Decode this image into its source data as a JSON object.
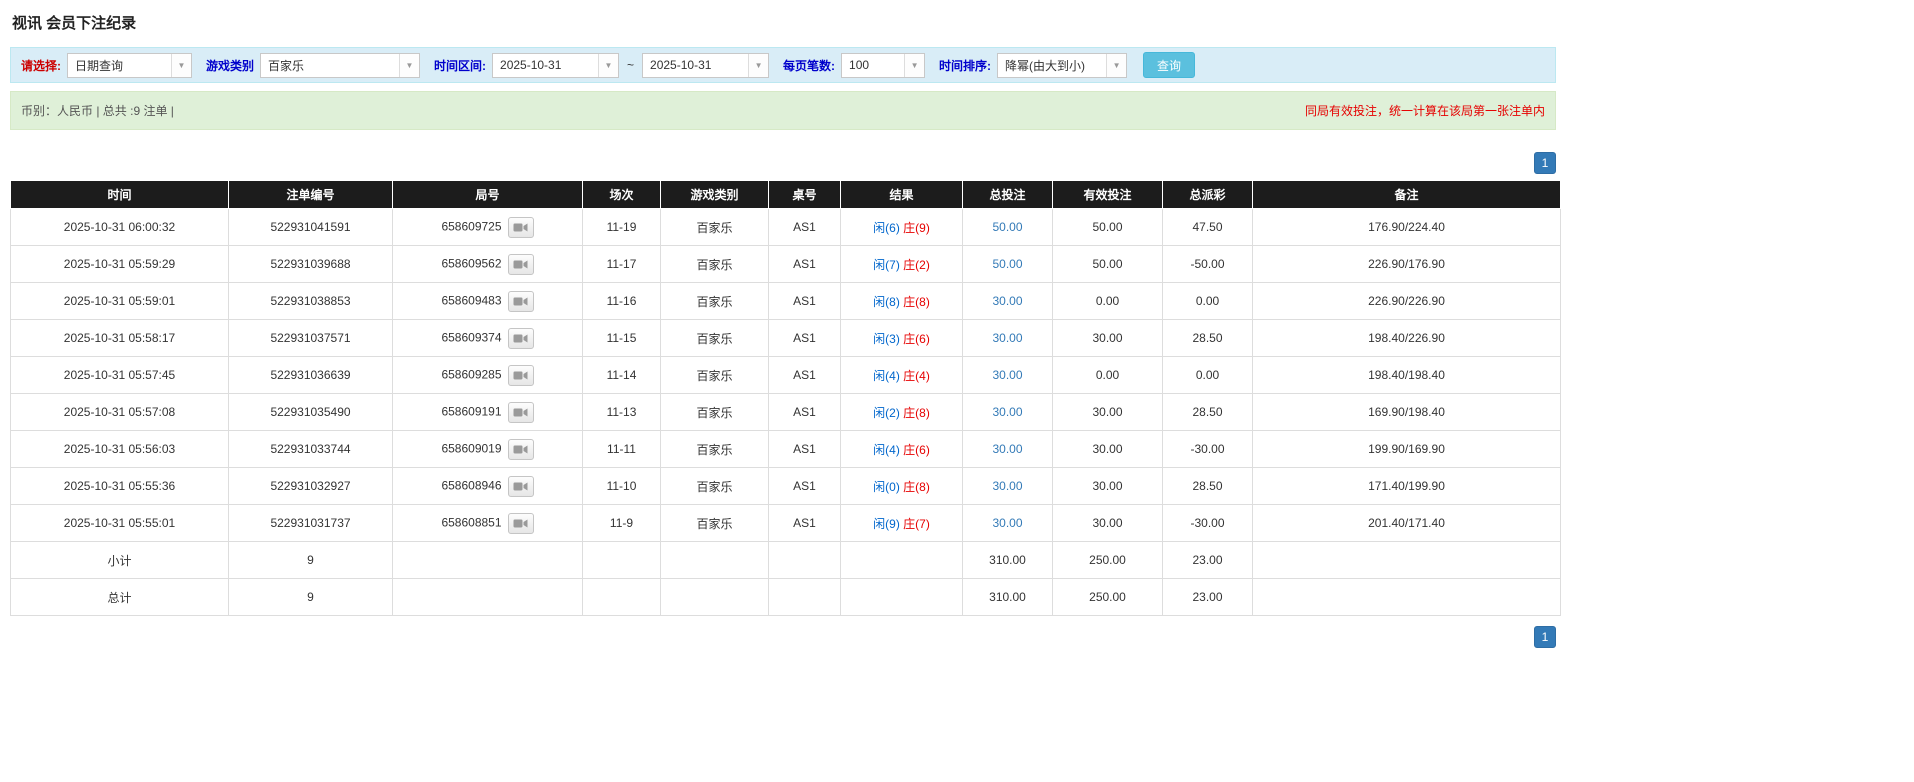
{
  "page": {
    "title": "视讯 会员下注纪录"
  },
  "filters": {
    "select_label": "请选择:",
    "select_value": "日期查询",
    "game_type_label": "游戏类别",
    "game_type_value": "百家乐",
    "date_range_label": "时间区间:",
    "date_from": "2025-10-31",
    "tilde": "~",
    "date_to": "2025-10-31",
    "page_size_label": "每页笔数:",
    "page_size_value": "100",
    "sort_label": "时间排序:",
    "sort_value": "降幂(由大到小)",
    "search_button": "查询",
    "dropdown_arrow": "▼"
  },
  "info_bar": {
    "left": "币别：人民币 | 总共 :9 注单 |",
    "right": "同局有效投注，统一计算在该局第一张注单内"
  },
  "pagination": {
    "page": "1"
  },
  "table": {
    "headers": [
      "时间",
      "注单编号",
      "局号",
      "场次",
      "游戏类别",
      "桌号",
      "结果",
      "总投注",
      "有效投注",
      "总派彩",
      "备注"
    ],
    "rows": [
      {
        "time": "2025-10-31 06:00:32",
        "bet_id": "522931041591",
        "round": "658609725",
        "session": "11-19",
        "game": "百家乐",
        "table_no": "AS1",
        "player": "闲(6)",
        "banker": "庄(9)",
        "total_bet": "50.00",
        "valid_bet": "50.00",
        "payout": "47.50",
        "remark": "176.90/224.40"
      },
      {
        "time": "2025-10-31 05:59:29",
        "bet_id": "522931039688",
        "round": "658609562",
        "session": "11-17",
        "game": "百家乐",
        "table_no": "AS1",
        "player": "闲(7)",
        "banker": "庄(2)",
        "total_bet": "50.00",
        "valid_bet": "50.00",
        "payout": "-50.00",
        "remark": "226.90/176.90"
      },
      {
        "time": "2025-10-31 05:59:01",
        "bet_id": "522931038853",
        "round": "658609483",
        "session": "11-16",
        "game": "百家乐",
        "table_no": "AS1",
        "player": "闲(8)",
        "banker": "庄(8)",
        "total_bet": "30.00",
        "valid_bet": "0.00",
        "payout": "0.00",
        "remark": "226.90/226.90"
      },
      {
        "time": "2025-10-31 05:58:17",
        "bet_id": "522931037571",
        "round": "658609374",
        "session": "11-15",
        "game": "百家乐",
        "table_no": "AS1",
        "player": "闲(3)",
        "banker": "庄(6)",
        "total_bet": "30.00",
        "valid_bet": "30.00",
        "payout": "28.50",
        "remark": "198.40/226.90"
      },
      {
        "time": "2025-10-31 05:57:45",
        "bet_id": "522931036639",
        "round": "658609285",
        "session": "11-14",
        "game": "百家乐",
        "table_no": "AS1",
        "player": "闲(4)",
        "banker": "庄(4)",
        "total_bet": "30.00",
        "valid_bet": "0.00",
        "payout": "0.00",
        "remark": "198.40/198.40"
      },
      {
        "time": "2025-10-31 05:57:08",
        "bet_id": "522931035490",
        "round": "658609191",
        "session": "11-13",
        "game": "百家乐",
        "table_no": "AS1",
        "player": "闲(2)",
        "banker": "庄(8)",
        "total_bet": "30.00",
        "valid_bet": "30.00",
        "payout": "28.50",
        "remark": "169.90/198.40"
      },
      {
        "time": "2025-10-31 05:56:03",
        "bet_id": "522931033744",
        "round": "658609019",
        "session": "11-11",
        "game": "百家乐",
        "table_no": "AS1",
        "player": "闲(4)",
        "banker": "庄(6)",
        "total_bet": "30.00",
        "valid_bet": "30.00",
        "payout": "-30.00",
        "remark": "199.90/169.90"
      },
      {
        "time": "2025-10-31 05:55:36",
        "bet_id": "522931032927",
        "round": "658608946",
        "session": "11-10",
        "game": "百家乐",
        "table_no": "AS1",
        "player": "闲(0)",
        "banker": "庄(8)",
        "total_bet": "30.00",
        "valid_bet": "30.00",
        "payout": "28.50",
        "remark": "171.40/199.90"
      },
      {
        "time": "2025-10-31 05:55:01",
        "bet_id": "522931031737",
        "round": "658608851",
        "session": "11-9",
        "game": "百家乐",
        "table_no": "AS1",
        "player": "闲(9)",
        "banker": "庄(7)",
        "total_bet": "30.00",
        "valid_bet": "30.00",
        "payout": "-30.00",
        "remark": "201.40/171.40"
      }
    ],
    "subtotal": {
      "label": "小计",
      "count": "9",
      "total_bet": "310.00",
      "valid_bet": "250.00",
      "payout": "23.00"
    },
    "total": {
      "label": "总计",
      "count": "9",
      "total_bet": "310.00",
      "valid_bet": "250.00",
      "payout": "23.00"
    }
  }
}
